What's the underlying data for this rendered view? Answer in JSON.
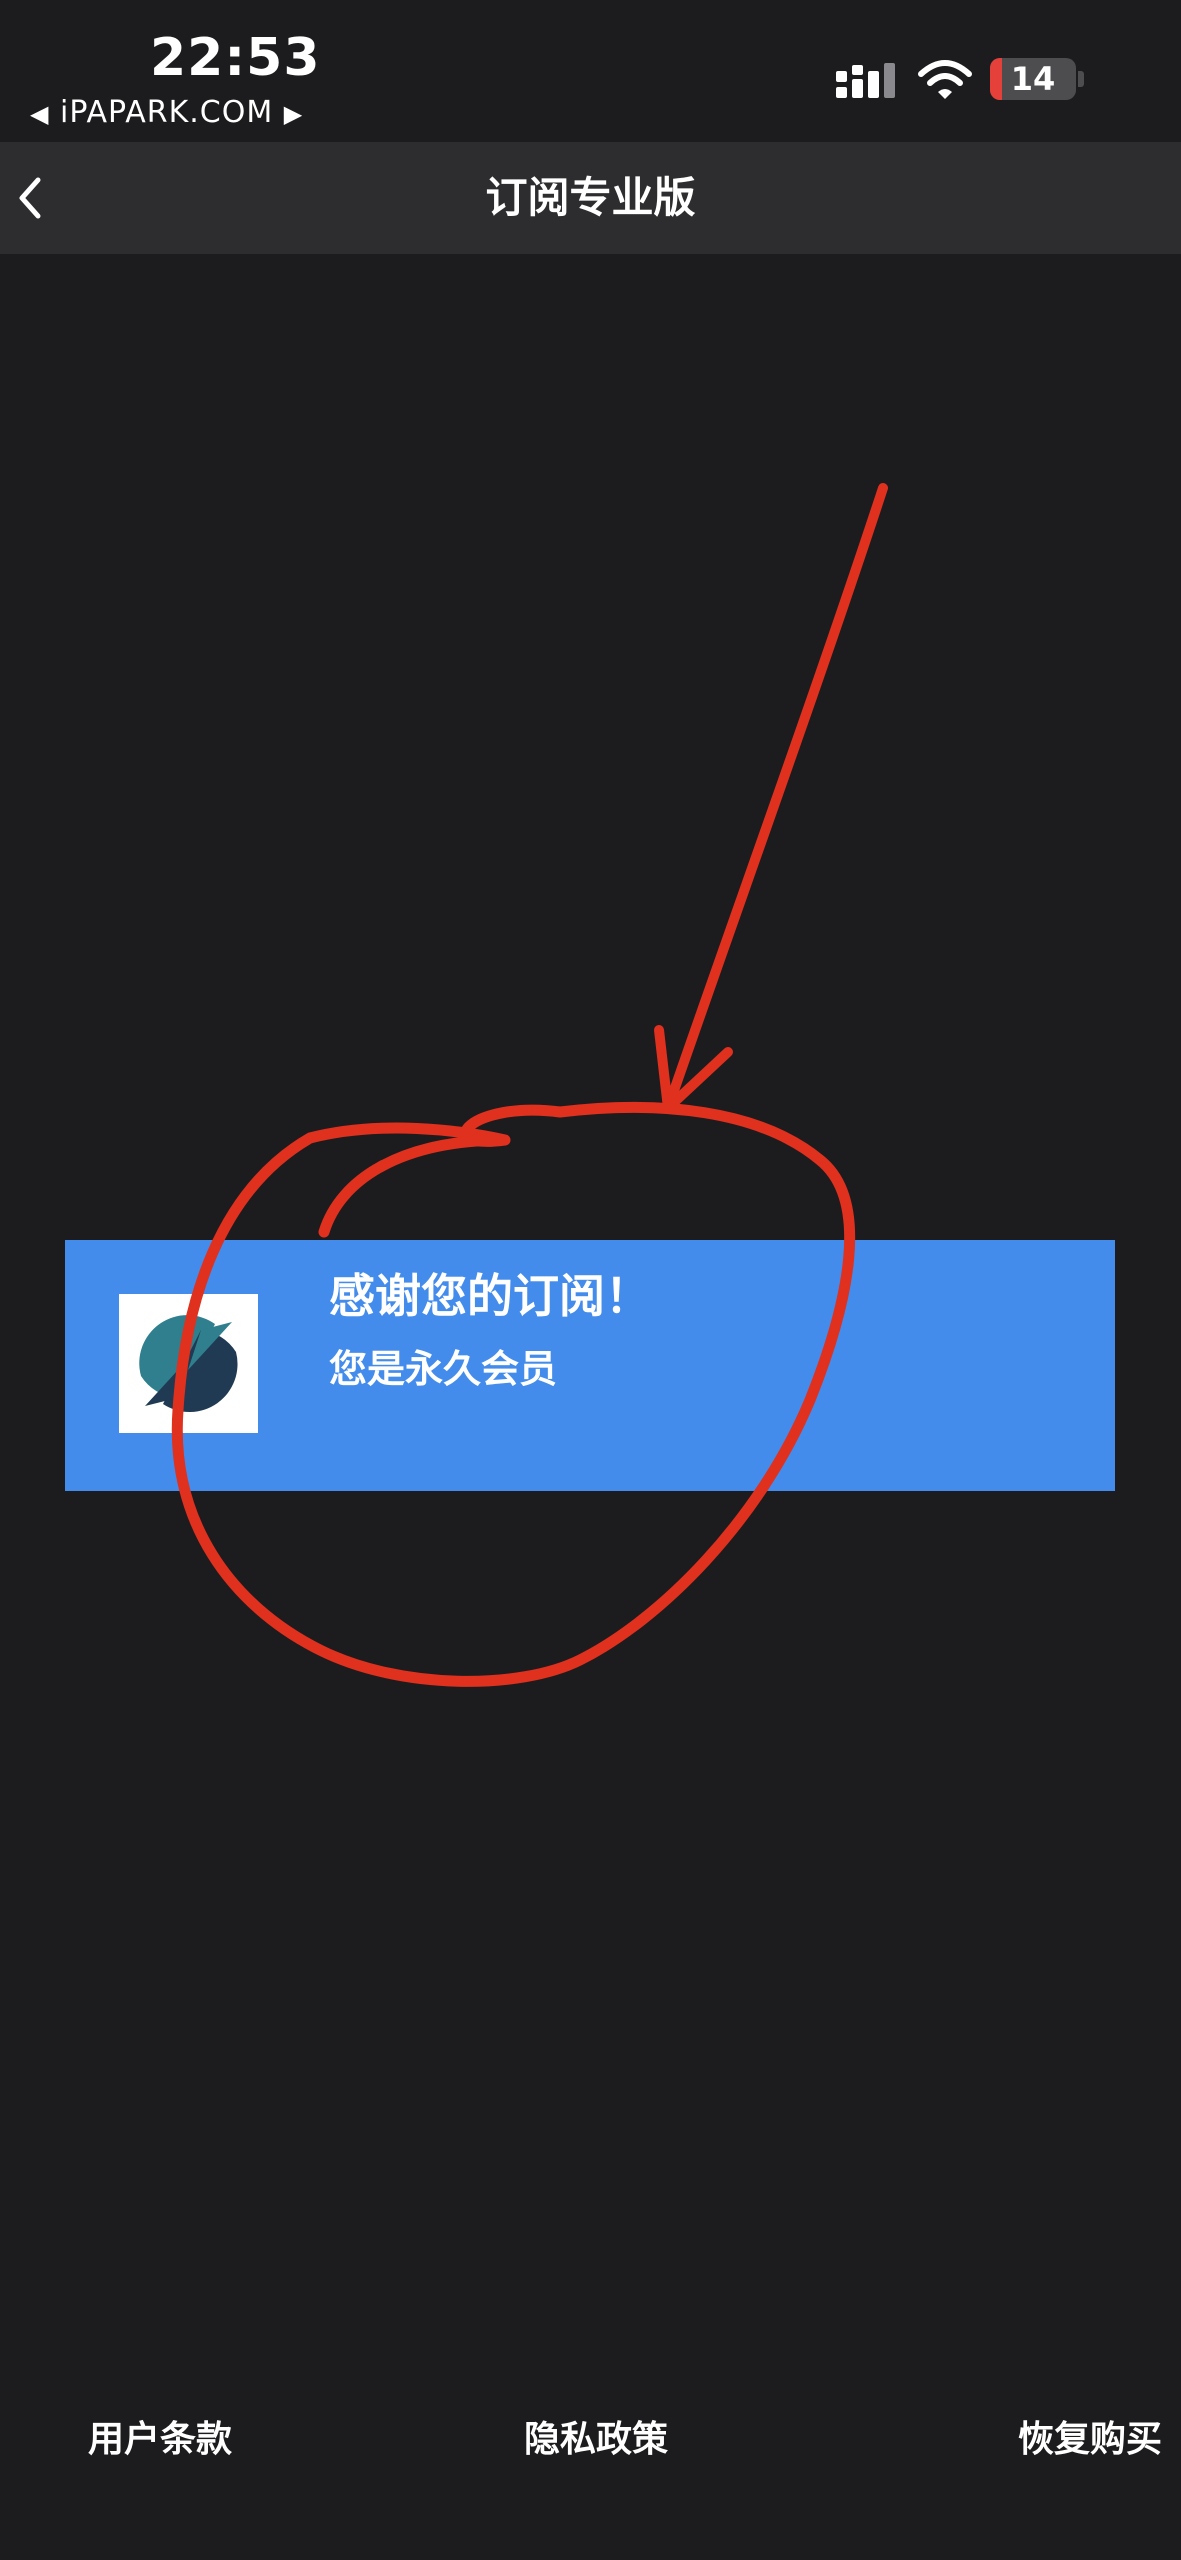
{
  "status_bar": {
    "time": "22:53",
    "carrier": "iPAPARK.COM",
    "carrier_prev": "◀",
    "carrier_next": "▶",
    "battery_level": "14",
    "battery_color": "#e5403a"
  },
  "nav": {
    "back_icon": "chevron-left-icon",
    "title": "订阅专业版"
  },
  "banner": {
    "background": "#438cec",
    "title": "感谢您的订阅！",
    "subtitle": "您是永久会员"
  },
  "annotation": {
    "color": "#e0301e",
    "shapes": [
      "arrow",
      "circle"
    ]
  },
  "footer": {
    "terms": "用户条款",
    "privacy": "隐私政策",
    "restore": "恢复购买"
  }
}
